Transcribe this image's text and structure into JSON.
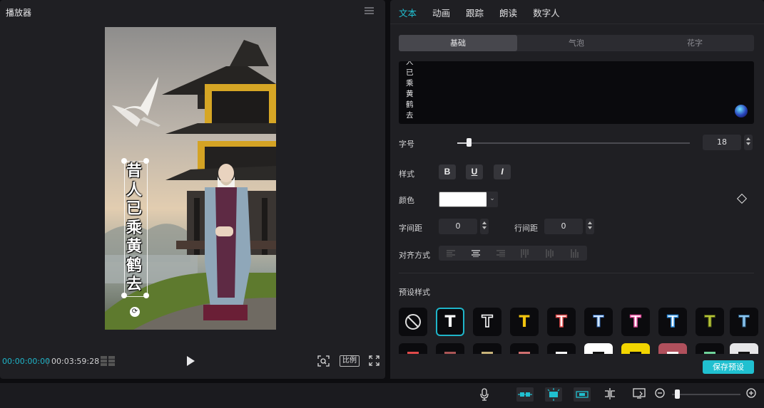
{
  "player": {
    "title": "播放器",
    "current_time": "00:00:00:00",
    "total_time": "00:03:59:28",
    "ratio_label": "比例",
    "overlay_text": "昔人已乘黄鹤去"
  },
  "inspector": {
    "tabs": [
      {
        "label": "文本",
        "active": true
      },
      {
        "label": "动画",
        "active": false
      },
      {
        "label": "跟踪",
        "active": false
      },
      {
        "label": "朗读",
        "active": false
      },
      {
        "label": "数字人",
        "active": false
      }
    ],
    "subtabs": [
      {
        "label": "基础",
        "active": true
      },
      {
        "label": "气泡",
        "active": false
      },
      {
        "label": "花字",
        "active": false
      }
    ],
    "text_value": "人已乘黄鹤去",
    "font_size_label": "字号",
    "font_size_value": "18",
    "font_size_fraction": 0.05,
    "style_label": "样式",
    "style_buttons": [
      "B",
      "U",
      "I"
    ],
    "color_label": "颜色",
    "color_value": "#ffffff",
    "letter_spacing_label": "字间距",
    "letter_spacing_value": "0",
    "line_spacing_label": "行间距",
    "line_spacing_value": "0",
    "align_label": "对齐方式",
    "preset_label": "预设样式",
    "save_preset_label": "保存预设"
  },
  "colors": {
    "accent": "#21c2d4",
    "panel": "#1f1f23",
    "background": "#0d0d10"
  },
  "bottom_toolbar": {
    "icons": [
      "microphone-icon",
      "link-main-track-icon",
      "snap-icon",
      "link-icon",
      "split-icon",
      "preview-axis-icon",
      "zoom-out-icon",
      "zoom-in-icon"
    ],
    "zoom_fraction": 0.07
  }
}
